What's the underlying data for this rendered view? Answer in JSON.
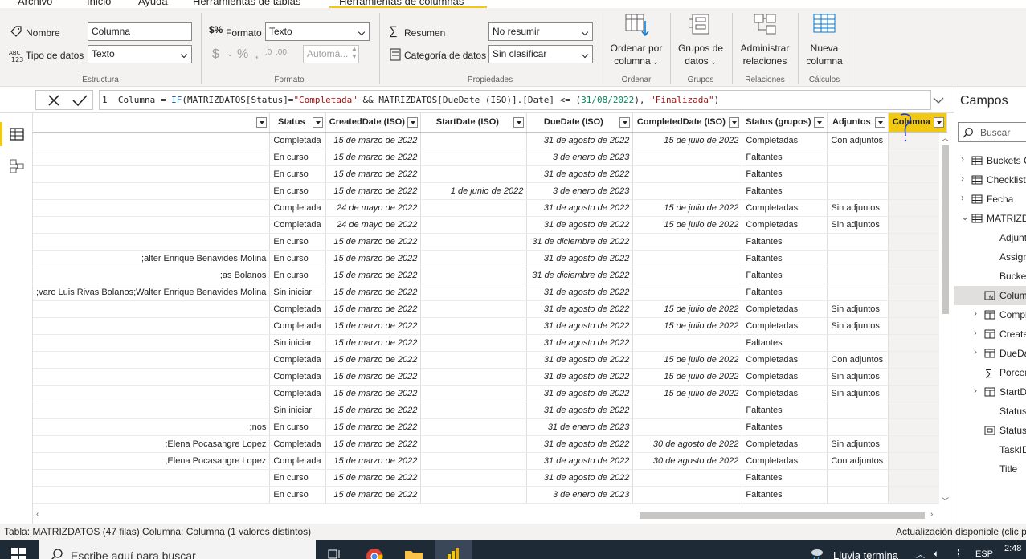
{
  "menubar": {
    "items": [
      "Archivo",
      "Inicio",
      "Ayuda",
      "Herramientas de tablas",
      "Herramientas de columnas"
    ]
  },
  "ribbon": {
    "estructura": {
      "nombre_label": "Nombre",
      "nombre_value": "Columna",
      "tipo_label": "Tipo de datos",
      "tipo_value": "Texto",
      "group": "Estructura"
    },
    "formato": {
      "formato_label": "Formato",
      "formato_value": "Texto",
      "decimal_value": "Automá...",
      "group": "Formato"
    },
    "propiedades": {
      "resumen_label": "Resumen",
      "resumen_value": "No resumir",
      "categoria_label": "Categoría de datos",
      "categoria_value": "Sin clasificar",
      "group": "Propiedades"
    },
    "ordenar": {
      "line1": "Ordenar por",
      "line2": "columna",
      "group": "Ordenar"
    },
    "grupos": {
      "line1": "Grupos de",
      "line2": "datos",
      "group": "Grupos"
    },
    "relaciones": {
      "line1": "Administrar",
      "line2": "relaciones",
      "group": "Relaciones"
    },
    "calculos": {
      "line1": "Nueva",
      "line2": "columna",
      "group": "Cálculos"
    }
  },
  "formula": {
    "line_no": "1",
    "p1": "Columna = ",
    "p2": "IF",
    "p3": "(MATRIZDATOS[Status]=",
    "p4": "\"Completada\"",
    "p5": " && MATRIZDATOS[DueDate (ISO)].[Date] <= (",
    "p6": "31/08/2022",
    "p7": "), ",
    "p8": "\"Finalizada\"",
    "p9": ")"
  },
  "table": {
    "columns": [
      "",
      "Status",
      "CreatedDate (ISO)",
      "StartDate (ISO)",
      "DueDate (ISO)",
      "CompletedDate (ISO)",
      "Status (grupos)",
      "Adjuntos",
      "Columna"
    ],
    "rows": [
      [
        "",
        "Completada",
        "15 de marzo de 2022",
        "",
        "31 de agosto de 2022",
        "15 de julio de 2022",
        "Completadas",
        "Con adjuntos",
        ""
      ],
      [
        "",
        "En curso",
        "15 de marzo de 2022",
        "",
        "3 de enero de 2023",
        "",
        "Faltantes",
        "",
        ""
      ],
      [
        "",
        "En curso",
        "15 de marzo de 2022",
        "",
        "31 de agosto de 2022",
        "",
        "Faltantes",
        "",
        ""
      ],
      [
        "",
        "En curso",
        "15 de marzo de 2022",
        "1 de junio de 2022",
        "3 de enero de 2023",
        "",
        "Faltantes",
        "",
        ""
      ],
      [
        "",
        "Completada",
        "24 de mayo de 2022",
        "",
        "31 de agosto de 2022",
        "15 de julio de 2022",
        "Completadas",
        "Sin adjuntos",
        ""
      ],
      [
        "",
        "Completada",
        "24 de mayo de 2022",
        "",
        "31 de agosto de 2022",
        "15 de julio de 2022",
        "Completadas",
        "Sin adjuntos",
        ""
      ],
      [
        "",
        "En curso",
        "15 de marzo de 2022",
        "",
        "31 de diciembre de 2022",
        "",
        "Faltantes",
        "",
        ""
      ],
      [
        "alter Enrique Benavides Molina;",
        "En curso",
        "15 de marzo de 2022",
        "",
        "31 de agosto de 2022",
        "",
        "Faltantes",
        "",
        ""
      ],
      [
        "as Bolanos;",
        "En curso",
        "15 de marzo de 2022",
        "",
        "31 de diciembre de 2022",
        "",
        "Faltantes",
        "",
        ""
      ],
      [
        "varo Luis Rivas Bolanos;Walter Enrique Benavides Molina;",
        "Sin iniciar",
        "15 de marzo de 2022",
        "",
        "31 de agosto de 2022",
        "",
        "Faltantes",
        "",
        ""
      ],
      [
        "",
        "Completada",
        "15 de marzo de 2022",
        "",
        "31 de agosto de 2022",
        "15 de julio de 2022",
        "Completadas",
        "Sin adjuntos",
        ""
      ],
      [
        "",
        "Completada",
        "15 de marzo de 2022",
        "",
        "31 de agosto de 2022",
        "15 de julio de 2022",
        "Completadas",
        "Sin adjuntos",
        ""
      ],
      [
        "",
        "Sin iniciar",
        "15 de marzo de 2022",
        "",
        "31 de agosto de 2022",
        "",
        "Faltantes",
        "",
        ""
      ],
      [
        "",
        "Completada",
        "15 de marzo de 2022",
        "",
        "31 de agosto de 2022",
        "15 de julio de 2022",
        "Completadas",
        "Con adjuntos",
        ""
      ],
      [
        "",
        "Completada",
        "15 de marzo de 2022",
        "",
        "31 de agosto de 2022",
        "15 de julio de 2022",
        "Completadas",
        "Sin adjuntos",
        ""
      ],
      [
        "",
        "Completada",
        "15 de marzo de 2022",
        "",
        "31 de agosto de 2022",
        "15 de julio de 2022",
        "Completadas",
        "Sin adjuntos",
        ""
      ],
      [
        "",
        "Sin iniciar",
        "15 de marzo de 2022",
        "",
        "31 de agosto de 2022",
        "",
        "Faltantes",
        "",
        ""
      ],
      [
        "nos;",
        "En curso",
        "15 de marzo de 2022",
        "",
        "31 de enero de 2023",
        "",
        "Faltantes",
        "",
        ""
      ],
      [
        "Elena Pocasangre  Lopez;",
        "Completada",
        "15 de marzo de 2022",
        "",
        "31 de agosto de 2022",
        "30 de agosto de 2022",
        "Completadas",
        "Sin adjuntos",
        ""
      ],
      [
        "Elena Pocasangre  Lopez;",
        "Completada",
        "15 de marzo de 2022",
        "",
        "31 de agosto de 2022",
        "30 de agosto de 2022",
        "Completadas",
        "Con adjuntos",
        ""
      ],
      [
        "",
        "En curso",
        "15 de marzo de 2022",
        "",
        "31 de agosto de 2022",
        "",
        "Faltantes",
        "",
        ""
      ],
      [
        "",
        "En curso",
        "15 de marzo de 2022",
        "",
        "3 de enero de 2023",
        "",
        "Faltantes",
        "",
        ""
      ]
    ]
  },
  "fields": {
    "title": "Campos",
    "search_placeholder": "Buscar",
    "items": [
      {
        "label": "Buckets C",
        "kind": "table",
        "indent": 0,
        "expand": "right"
      },
      {
        "label": "Checklist",
        "kind": "table",
        "indent": 0,
        "expand": "right"
      },
      {
        "label": "Fecha",
        "kind": "table",
        "indent": 0,
        "expand": "right"
      },
      {
        "label": "MATRIZD",
        "kind": "table",
        "indent": 0,
        "expand": "down"
      },
      {
        "label": "Adjunt",
        "kind": "field",
        "indent": 1,
        "expand": ""
      },
      {
        "label": "Assign",
        "kind": "field",
        "indent": 1,
        "expand": ""
      },
      {
        "label": "Bucket",
        "kind": "field",
        "indent": 1,
        "expand": ""
      },
      {
        "label": "Colum",
        "kind": "calc",
        "indent": 1,
        "expand": "",
        "selected": true
      },
      {
        "label": "Compl",
        "kind": "date",
        "indent": 1,
        "expand": "right"
      },
      {
        "label": "Create",
        "kind": "date",
        "indent": 1,
        "expand": "right"
      },
      {
        "label": "DueDa",
        "kind": "date",
        "indent": 1,
        "expand": "right"
      },
      {
        "label": "Porcen",
        "kind": "sigma",
        "indent": 1,
        "expand": ""
      },
      {
        "label": "StartDa",
        "kind": "date",
        "indent": 1,
        "expand": "right"
      },
      {
        "label": "Status",
        "kind": "field",
        "indent": 1,
        "expand": ""
      },
      {
        "label": "Status",
        "kind": "group",
        "indent": 1,
        "expand": ""
      },
      {
        "label": "TaskID",
        "kind": "field",
        "indent": 1,
        "expand": ""
      },
      {
        "label": "Title",
        "kind": "field",
        "indent": 1,
        "expand": ""
      }
    ]
  },
  "status": {
    "left": "Tabla: MATRIZDATOS (47 filas) Columna: Columna (1 valores distintos)",
    "right": "Actualización disponible (clic p"
  },
  "taskbar": {
    "search_placeholder": "Escribe aquí para buscar",
    "weather": "Lluvia termina",
    "lang": "ESP",
    "time": "2:48"
  },
  "colors": {
    "accent": "#f2c811",
    "brand": "#f2c811"
  }
}
